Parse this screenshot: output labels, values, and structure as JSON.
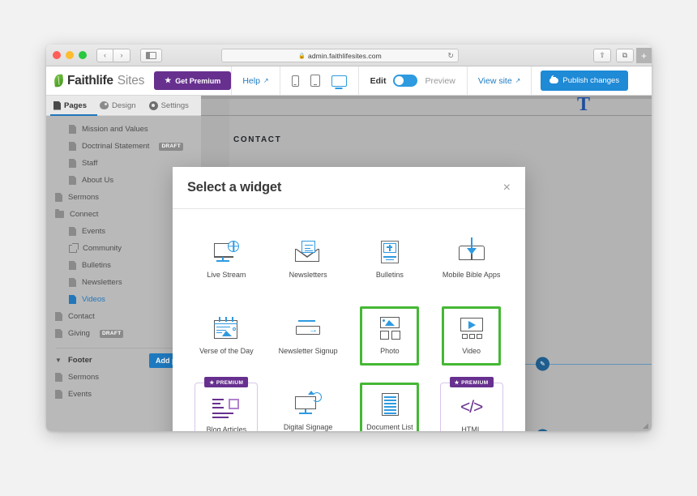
{
  "browser": {
    "url": "admin.faithlifesites.com",
    "lock_icon": "lock-icon",
    "reload_icon": "reload-icon",
    "back_label": "‹",
    "forward_label": "›",
    "share_label": "⇧",
    "tabs_label": "⧉",
    "new_tab_label": "+"
  },
  "header": {
    "brand_primary": "Faithlife",
    "brand_secondary": "Sites",
    "get_premium": "Get Premium",
    "help": "Help",
    "edit_label": "Edit",
    "preview_label": "Preview",
    "view_site": "View site",
    "publish": "Publish changes",
    "toggle_state": "edit",
    "accent_blue": "#1f8ad6",
    "premium_purple": "#67308f"
  },
  "sidebar": {
    "tabs": [
      {
        "label": "Pages",
        "icon": "document-icon",
        "active": true
      },
      {
        "label": "Design",
        "icon": "palette-icon",
        "active": false
      },
      {
        "label": "Settings",
        "icon": "gear-icon",
        "active": false
      }
    ],
    "add_page_label": "Add page",
    "footer_label": "Footer",
    "pages": [
      {
        "label": "Mission and Values",
        "icon": "page-icon",
        "indent": true
      },
      {
        "label": "Doctrinal Statement",
        "icon": "page-icon",
        "indent": true,
        "badge": "DRAFT"
      },
      {
        "label": "Staff",
        "icon": "page-icon",
        "indent": true
      },
      {
        "label": "About Us",
        "icon": "page-icon",
        "indent": true
      },
      {
        "label": "Sermons",
        "icon": "page-icon",
        "indent": false
      },
      {
        "label": "Connect",
        "icon": "folder-icon",
        "indent": false
      },
      {
        "label": "Events",
        "icon": "page-icon",
        "indent": true
      },
      {
        "label": "Community",
        "icon": "external-link-icon",
        "indent": true
      },
      {
        "label": "Bulletins",
        "icon": "page-icon",
        "indent": true
      },
      {
        "label": "Newsletters",
        "icon": "page-icon",
        "indent": true
      },
      {
        "label": "Videos",
        "icon": "page-icon",
        "indent": true,
        "selected": true
      },
      {
        "label": "Contact",
        "icon": "page-icon",
        "indent": false
      },
      {
        "label": "Giving",
        "icon": "page-icon",
        "indent": false,
        "badge": "DRAFT"
      }
    ],
    "footer_pages": [
      {
        "label": "Sermons",
        "icon": "page-icon"
      },
      {
        "label": "Events",
        "icon": "page-icon"
      }
    ]
  },
  "canvas": {
    "section_label": "CONTACT",
    "text_tool_label": "T",
    "edit_pencil_icon": "pencil-icon"
  },
  "modal": {
    "title": "Select a widget",
    "close_label": "×",
    "selected_border_color": "#45b834",
    "premium_badge_label": "PREMIUM",
    "widgets": [
      {
        "label": "Live Stream",
        "icon": "live-stream-icon",
        "selected": false,
        "premium": false
      },
      {
        "label": "Newsletters",
        "icon": "newsletters-icon",
        "selected": false,
        "premium": false
      },
      {
        "label": "Bulletins",
        "icon": "bulletins-icon",
        "selected": false,
        "premium": false
      },
      {
        "label": "Mobile Bible Apps",
        "icon": "mobile-bible-apps-icon",
        "selected": false,
        "premium": false
      },
      {
        "label": "Verse of the Day",
        "icon": "verse-of-the-day-icon",
        "selected": false,
        "premium": false
      },
      {
        "label": "Newsletter Signup",
        "icon": "newsletter-signup-icon",
        "selected": false,
        "premium": false
      },
      {
        "label": "Photo",
        "icon": "photo-icon",
        "selected": true,
        "premium": false
      },
      {
        "label": "Video",
        "icon": "video-icon",
        "selected": true,
        "premium": false
      },
      {
        "label": "Blog Articles",
        "icon": "blog-articles-icon",
        "selected": false,
        "premium": true
      },
      {
        "label": "Digital Signage",
        "icon": "digital-signage-icon",
        "selected": false,
        "premium": false
      },
      {
        "label": "Document List",
        "icon": "document-list-icon",
        "selected": true,
        "premium": false
      },
      {
        "label": "HTML",
        "icon": "html-icon",
        "selected": false,
        "premium": true
      }
    ]
  }
}
